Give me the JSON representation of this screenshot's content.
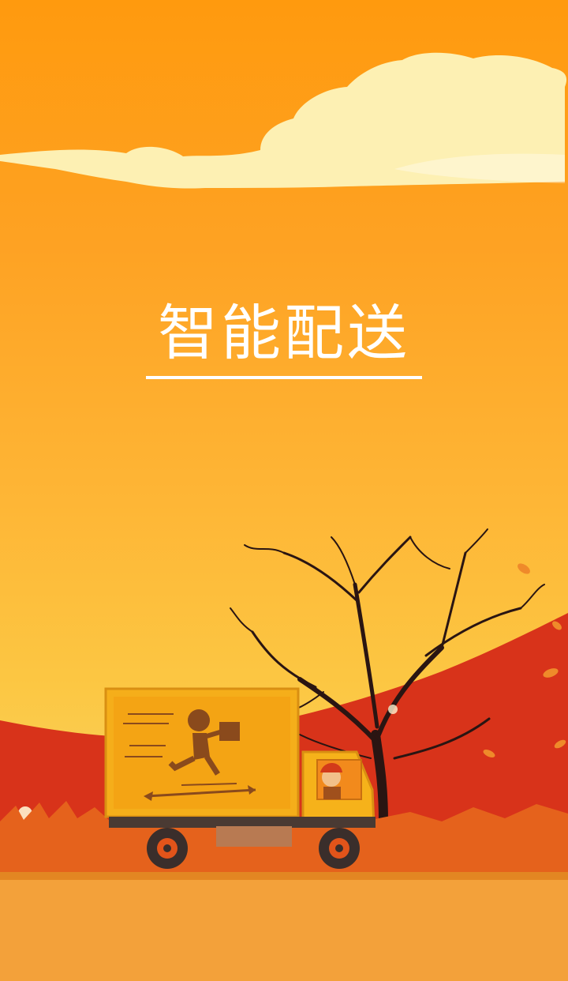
{
  "splash": {
    "title": "智能配送"
  },
  "illustration": {
    "elements": [
      "cloud",
      "tree",
      "hill",
      "grass",
      "delivery-truck",
      "courier-logo",
      "driver",
      "falling-leaves",
      "road"
    ]
  },
  "colors": {
    "sky_top": "#ff9a0e",
    "sky_bottom": "#f9cf55",
    "hill": "#d8331a",
    "grass": "#e5621c",
    "road": "#f3a13a",
    "truck_body": "#f5ae1a",
    "title_text": "#ffffff"
  }
}
